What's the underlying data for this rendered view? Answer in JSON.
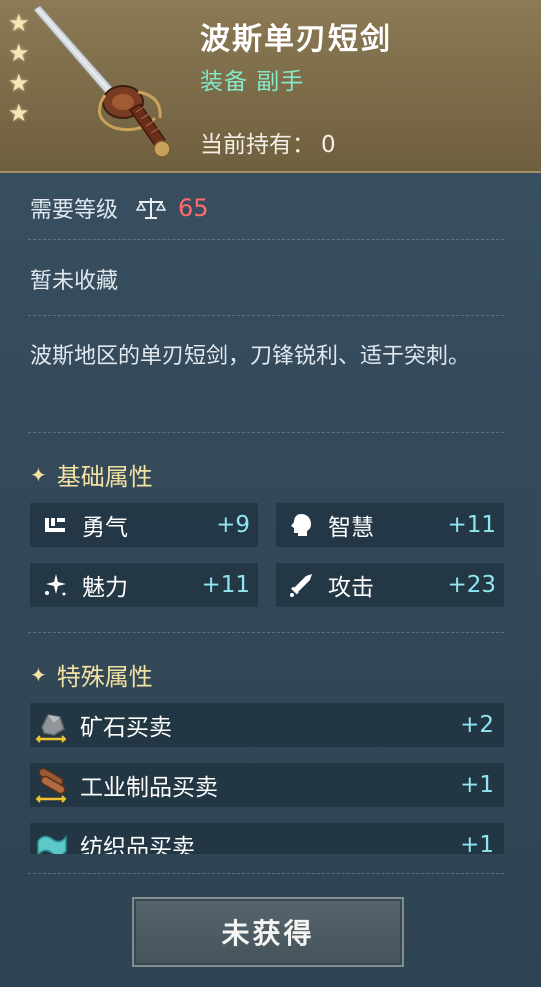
{
  "item": {
    "name": "波斯单刃短剑",
    "type": "装备 副手",
    "holding_label": "当前持有：",
    "holding_value": "0",
    "stars": 4
  },
  "level": {
    "label": "需要等级",
    "value": "65"
  },
  "collection_status": "暂未收藏",
  "description": "波斯地区的单刃短剑，刀锋锐利、适于突刺。",
  "basic_attributes": {
    "title": "基础属性",
    "items": [
      {
        "label": "勇气",
        "value": "+9",
        "icon": "courage-icon"
      },
      {
        "label": "智慧",
        "value": "+11",
        "icon": "wisdom-head-icon"
      },
      {
        "label": "魅力",
        "value": "+11",
        "icon": "charm-sparkle-icon"
      },
      {
        "label": "攻击",
        "value": "+23",
        "icon": "attack-sword-icon"
      }
    ]
  },
  "special_attributes": {
    "title": "特殊属性",
    "items": [
      {
        "label": "矿石买卖",
        "value": "+2",
        "icon": "ore-trade-icon"
      },
      {
        "label": "工业制品买卖",
        "value": "+1",
        "icon": "industrial-goods-trade-icon"
      },
      {
        "label": "纺织品买卖",
        "value": "+1",
        "icon": "textile-trade-icon"
      }
    ]
  },
  "action_button": "未获得",
  "colors": {
    "header_bg": "#7c6b48",
    "panel_bg": "#34495a",
    "type_text": "#84e7c6",
    "level_value": "#ff6b6b",
    "stat_value": "#8fe6f2",
    "section_title": "#f3e2a3"
  }
}
